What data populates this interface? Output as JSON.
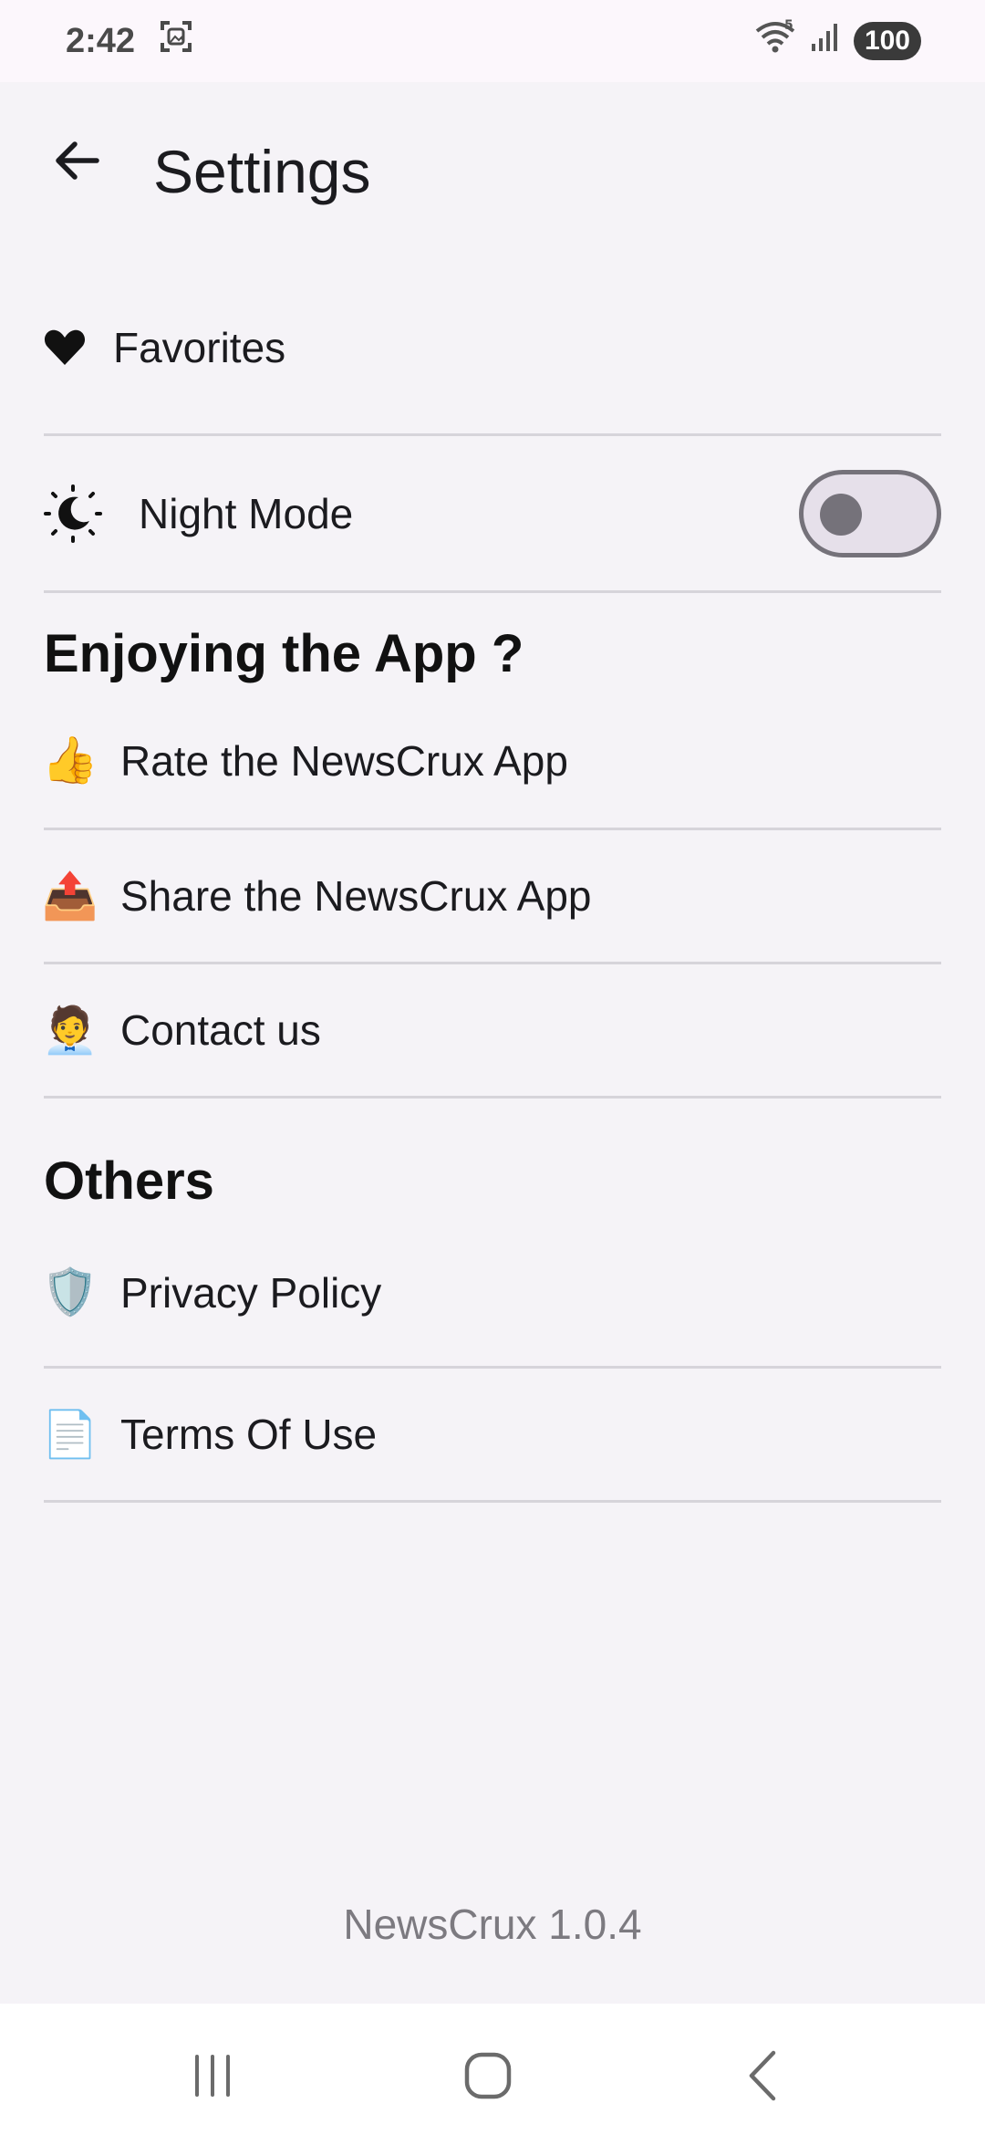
{
  "status_bar": {
    "time": "2:42",
    "battery": "100",
    "network": "5"
  },
  "app_bar": {
    "title": "Settings"
  },
  "items": {
    "favorites": {
      "label": "Favorites",
      "icon": "heart-icon"
    },
    "night_mode": {
      "label": "Night Mode",
      "icon": "night-mode-icon",
      "enabled": false
    }
  },
  "sections": {
    "enjoying": {
      "title": "Enjoying the App ?",
      "items": [
        {
          "label": "Rate the NewsCrux App",
          "emoji": "👍",
          "icon": "thumbs-up-icon"
        },
        {
          "label": "Share the NewsCrux App",
          "emoji": "📤",
          "icon": "outbox-tray-icon"
        },
        {
          "label": "Contact us",
          "emoji": "🧑‍💼",
          "icon": "office-worker-icon"
        }
      ]
    },
    "others": {
      "title": "Others",
      "items": [
        {
          "label": "Privacy Policy",
          "emoji": "🛡️",
          "icon": "shield-icon"
        },
        {
          "label": "Terms Of Use",
          "emoji": "📄",
          "icon": "document-icon"
        }
      ]
    }
  },
  "footer": {
    "version": "NewsCrux 1.0.4"
  }
}
